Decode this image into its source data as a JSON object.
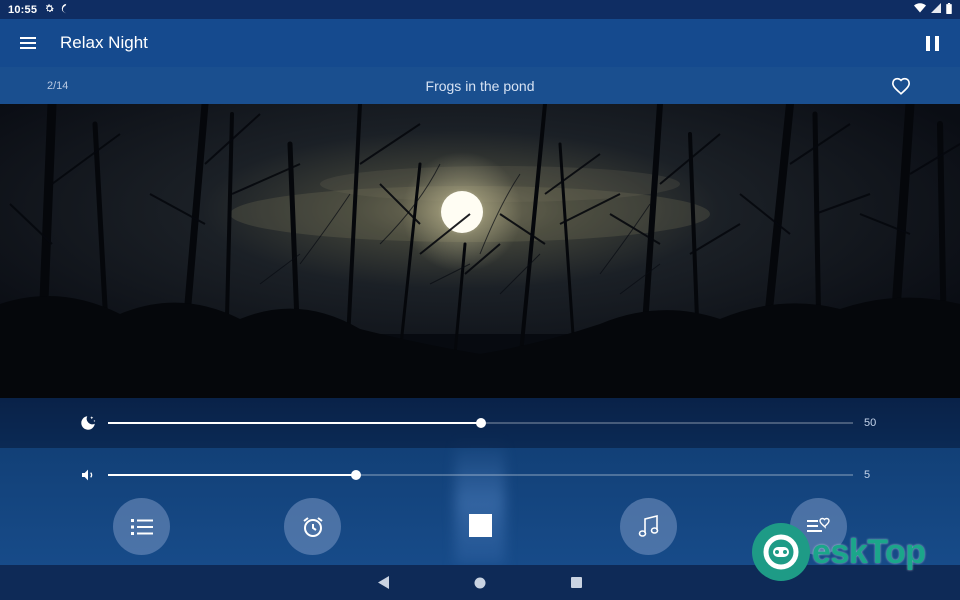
{
  "status": {
    "time": "10:55",
    "left_icons": [
      "gear-icon",
      "moon-icon"
    ],
    "right_icons": [
      "wifi-icon",
      "signal-icon",
      "battery-icon"
    ]
  },
  "app_bar": {
    "title": "Relax Night",
    "menu_icon": "hamburger-menu-icon",
    "pause_icon": "pause-icon"
  },
  "track": {
    "index": "2/14",
    "title": "Frogs in the pond",
    "favorite_icon": "heart-outline-icon"
  },
  "sliders": {
    "timer": {
      "icon": "moon-stars-icon",
      "value": "50",
      "fraction": 0.5
    },
    "volume": {
      "icon": "speaker-icon",
      "value": "5",
      "fraction": 0.333
    }
  },
  "actions": {
    "items": [
      {
        "icon": "list-icon"
      },
      {
        "icon": "alarm-clock-icon"
      },
      {
        "icon": "stop-icon"
      },
      {
        "icon": "music-note-icon"
      },
      {
        "icon": "favorites-list-icon"
      }
    ]
  },
  "nav": {
    "items": [
      "back-icon",
      "home-icon",
      "recents-icon"
    ]
  },
  "watermark": {
    "text": "eskTop"
  },
  "colors": {
    "status_bar": "#0f2d63",
    "app_bar": "#154a8e",
    "info_bar": "#1a4f8f",
    "controls": "#174b89",
    "nav_bar": "#0e2a57",
    "watermark": "#1ba68a"
  }
}
